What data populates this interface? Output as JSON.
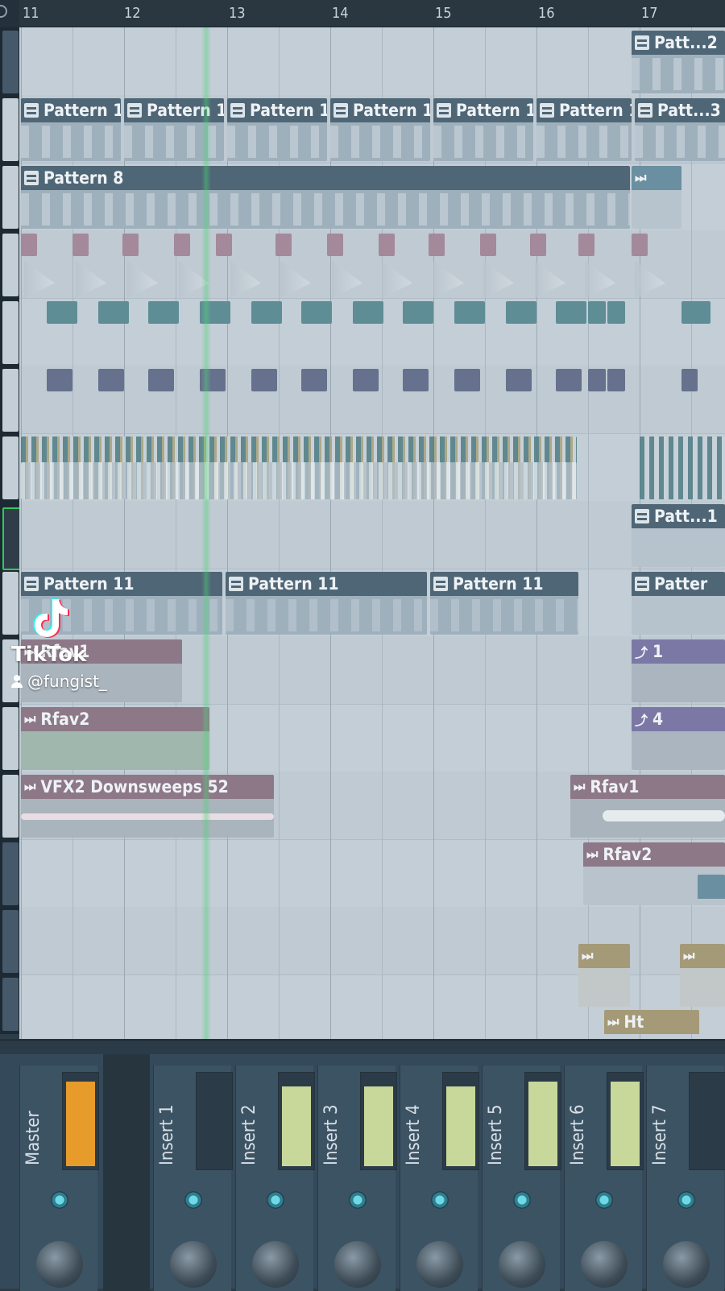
{
  "ruler": {
    "bars": [
      "11",
      "12",
      "13",
      "14",
      "15",
      "16",
      "17"
    ]
  },
  "clips": {
    "pattern1": "Pattern 1",
    "patt2": "Patt...2",
    "patt3": "Patt...3",
    "pattern8": "Pattern 8",
    "patt1_right": "Patt...1",
    "pattern11": "Pattern 11",
    "pattern11_right": "Patter",
    "rfav1_left": "Rfav1",
    "rfav2_left": "Rfav2",
    "auto1": "1",
    "auto4": "4",
    "vfx2": "VFX2 Downsweeps 52",
    "rfav1_right": "Rfav1",
    "rfav2_right": "Rfav2",
    "ht": "Ht"
  },
  "mixer": {
    "strips": [
      {
        "name": "Master",
        "level": 0.95
      },
      {
        "name": "Insert 1",
        "level": 0
      },
      {
        "name": "Insert 2",
        "level": 0.9
      },
      {
        "name": "Insert 3",
        "level": 0.9
      },
      {
        "name": "Insert 4",
        "level": 0.9
      },
      {
        "name": "Insert 5",
        "level": 0.95
      },
      {
        "name": "Insert 6",
        "level": 0.95
      },
      {
        "name": "Insert 7",
        "level": 0
      }
    ]
  },
  "watermark": {
    "brand": "TikTok",
    "user": "@fungist_"
  },
  "colors": {
    "pattern": "#4f6676",
    "audio_pink": "#8d7888",
    "automation": "#7b78a6",
    "meter": "#c8d79a",
    "master_meter": "#e79b2a",
    "playhead": "#50d278"
  }
}
